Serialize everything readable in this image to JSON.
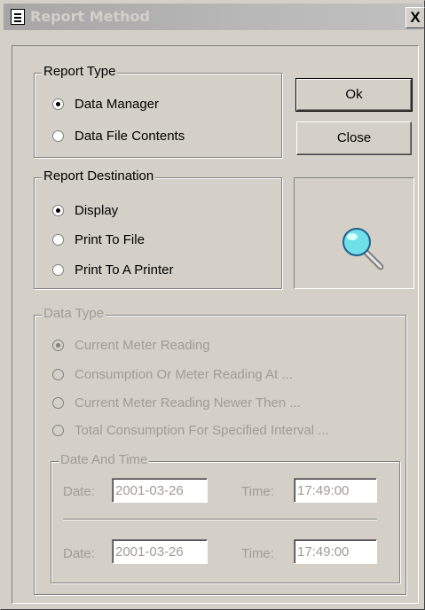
{
  "window": {
    "title": "Report Method",
    "close_glyph": "X"
  },
  "report_type": {
    "legend": "Report Type",
    "options": [
      {
        "label": "Data Manager",
        "checked": true
      },
      {
        "label": "Data File Contents",
        "checked": false
      }
    ]
  },
  "buttons": {
    "ok": "Ok",
    "close": "Close"
  },
  "report_destination": {
    "legend": "Report Destination",
    "options": [
      {
        "label": "Display",
        "checked": true
      },
      {
        "label": "Print To File",
        "checked": false
      },
      {
        "label": "Print To A Printer",
        "checked": false
      }
    ]
  },
  "preview_icon": "magnifier-icon",
  "data_type": {
    "legend": "Data Type",
    "enabled": false,
    "options": [
      {
        "label": "Current Meter Reading",
        "checked": true
      },
      {
        "label": "Consumption Or Meter Reading At ...",
        "checked": false
      },
      {
        "label": "Current Meter Reading Newer Then ...",
        "checked": false
      },
      {
        "label": "Total Consumption For Specified Interval ...",
        "checked": false
      }
    ]
  },
  "date_and_time": {
    "legend": "Date And Time",
    "rows": [
      {
        "date_label": "Date:",
        "date": "2001-03-26",
        "time_label": "Time:",
        "time": "17:49:00"
      },
      {
        "date_label": "Date:",
        "date": "2001-03-26",
        "time_label": "Time:",
        "time": "17:49:00"
      }
    ]
  },
  "colors": {
    "face": "#d4d0c8",
    "disabled_text": "#a09c96",
    "magnifier_lens": "#6fe0e8"
  }
}
